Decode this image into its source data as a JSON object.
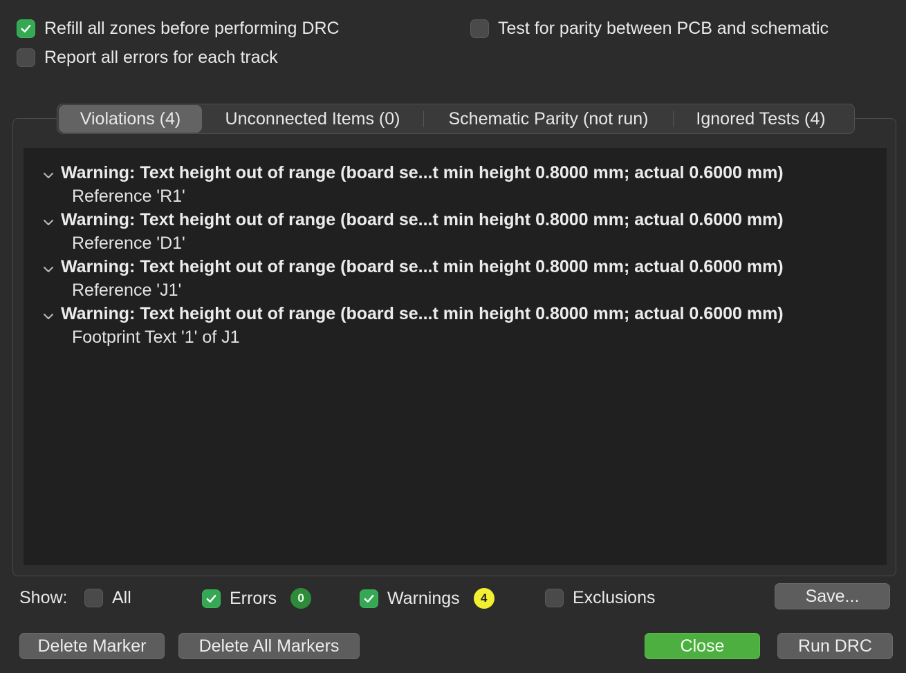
{
  "options": {
    "refill_zones": {
      "label": "Refill all zones before performing DRC",
      "checked": true
    },
    "report_all_errors": {
      "label": "Report all errors for each track",
      "checked": false
    },
    "test_parity": {
      "label": "Test for parity between PCB and schematic",
      "checked": false
    }
  },
  "tabs": [
    {
      "label": "Violations (4)",
      "active": true
    },
    {
      "label": "Unconnected Items (0)",
      "active": false
    },
    {
      "label": "Schematic Parity (not run)",
      "active": false
    },
    {
      "label": "Ignored Tests (4)",
      "active": false
    }
  ],
  "violations": [
    {
      "title": "Warning: Text height out of range (board se...t min height 0.8000 mm; actual 0.6000 mm)",
      "item": "Reference 'R1'"
    },
    {
      "title": "Warning: Text height out of range (board se...t min height 0.8000 mm; actual 0.6000 mm)",
      "item": "Reference 'D1'"
    },
    {
      "title": "Warning: Text height out of range (board se...t min height 0.8000 mm; actual 0.6000 mm)",
      "item": "Reference 'J1'"
    },
    {
      "title": "Warning: Text height out of range (board se...t min height 0.8000 mm; actual 0.6000 mm)",
      "item": "Footprint Text '1' of J1"
    }
  ],
  "filters": {
    "show_label": "Show:",
    "all": {
      "label": "All",
      "checked": false
    },
    "errors": {
      "label": "Errors",
      "checked": true,
      "count": "0",
      "badge_color": "#2e8b3a"
    },
    "warnings": {
      "label": "Warnings",
      "checked": true,
      "count": "4",
      "badge_color": "#f3f032"
    },
    "exclusions": {
      "label": "Exclusions",
      "checked": false
    }
  },
  "buttons": {
    "save": "Save...",
    "delete_marker": "Delete Marker",
    "delete_all_markers": "Delete All Markers",
    "close": "Close",
    "run_drc": "Run DRC"
  },
  "colors": {
    "accent_green": "#34a853",
    "primary_button": "#4caf3f",
    "background": "#2c2c2c",
    "list_background": "#202020"
  }
}
